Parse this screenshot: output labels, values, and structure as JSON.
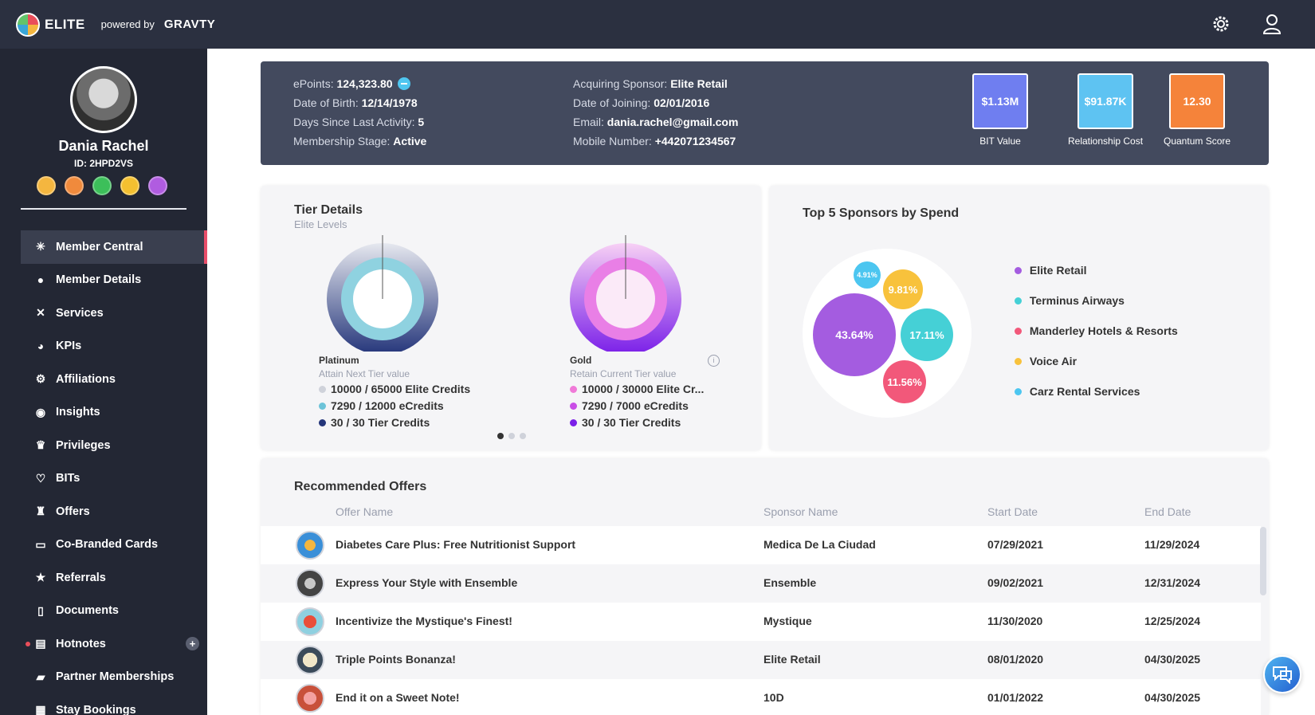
{
  "header": {
    "brand": "ELITE",
    "powered_by": "powered by",
    "platform": "GRAVTY"
  },
  "profile": {
    "name": "Dania Rachel",
    "id_label": "ID: 2HPD2VS",
    "badge_colors": [
      "#f4b63f",
      "#f08a3c",
      "#3cbf5a",
      "#f4c030",
      "#b05ce0"
    ]
  },
  "nav": [
    {
      "label": "Member Central",
      "icon": "asterisk-icon"
    },
    {
      "label": "Member Details",
      "icon": "person-icon"
    },
    {
      "label": "Services",
      "icon": "tools-icon"
    },
    {
      "label": "KPIs",
      "icon": "pie-icon"
    },
    {
      "label": "Affiliations",
      "icon": "gear-icon"
    },
    {
      "label": "Insights",
      "icon": "bulb-icon"
    },
    {
      "label": "Privileges",
      "icon": "crown-icon"
    },
    {
      "label": "BITs",
      "icon": "heart-pulse-icon"
    },
    {
      "label": "Offers",
      "icon": "trophy-icon"
    },
    {
      "label": "Co-Branded Cards",
      "icon": "card-icon"
    },
    {
      "label": "Referrals",
      "icon": "star-icon"
    },
    {
      "label": "Documents",
      "icon": "document-icon"
    },
    {
      "label": "Hotnotes",
      "icon": "notepad-icon"
    },
    {
      "label": "Partner Memberships",
      "icon": "partner-icon"
    },
    {
      "label": "Stay Bookings",
      "icon": "building-icon"
    }
  ],
  "summary": {
    "epoints_label": "ePoints:",
    "epoints": "124,323.80",
    "dob_label": "Date of Birth:",
    "dob": "12/14/1978",
    "days_label": "Days Since Last Activity:",
    "days": "5",
    "stage_label": "Membership Stage:",
    "stage": "Active",
    "sponsor_label": "Acquiring Sponsor:",
    "sponsor": "Elite Retail",
    "joining_label": "Date of Joining:",
    "joining": "02/01/2016",
    "email_label": "Email:",
    "email": "dania.rachel@gmail.com",
    "mobile_label": "Mobile Number:",
    "mobile": "+442071234567"
  },
  "kpis": [
    {
      "value": "$1.13M",
      "label": "BIT Value",
      "color": "#6f7ef0"
    },
    {
      "value": "$91.87K",
      "label": "Relationship Cost",
      "color": "#5ec3f2"
    },
    {
      "value": "12.30",
      "label": "Quantum Score",
      "color": "#f5833a"
    }
  ],
  "tier": {
    "title": "Tier Details",
    "subtitle": "Elite Levels",
    "left": {
      "name": "Platinum",
      "hint": "Attain Next Tier value",
      "stats": [
        {
          "text": "10000 / 65000 Elite Credits",
          "color": "#cfd2da"
        },
        {
          "text": "7290 / 12000 eCredits",
          "color": "#6cc3d8"
        },
        {
          "text": "30 / 30 Tier Credits",
          "color": "#24357a"
        }
      ]
    },
    "right": {
      "name": "Gold",
      "hint": "Retain Current Tier value",
      "stats": [
        {
          "text": "10000 / 30000 Elite Cr...",
          "color": "#f07ad8"
        },
        {
          "text": "7290 / 7000 eCredits",
          "color": "#c94ee6"
        },
        {
          "text": "30 / 30 Tier Credits",
          "color": "#7a1fe8"
        }
      ]
    }
  },
  "sponsors": {
    "title": "Top 5 Sponsors by Spend",
    "bubbles": [
      "43.64%",
      "17.11%",
      "11.56%",
      "9.81%",
      "4.91%"
    ],
    "legend": [
      {
        "name": "Elite Retail",
        "color": "#a45ce0"
      },
      {
        "name": "Terminus Airways",
        "color": "#45d0d6"
      },
      {
        "name": "Manderley Hotels & Resorts",
        "color": "#f2587a"
      },
      {
        "name": "Voice Air",
        "color": "#f8c23c"
      },
      {
        "name": "Carz Rental Services",
        "color": "#4cc6f0"
      }
    ]
  },
  "offers": {
    "title": "Recommended Offers",
    "columns": [
      "Offer Name",
      "Sponsor Name",
      "Start Date",
      "End Date"
    ],
    "rows": [
      {
        "name": "Diabetes Care Plus: Free Nutritionist Support",
        "sponsor": "Medica De La Ciudad",
        "start": "07/29/2021",
        "end": "11/29/2024"
      },
      {
        "name": "Express Your Style with Ensemble",
        "sponsor": "Ensemble",
        "start": "09/02/2021",
        "end": "12/31/2024"
      },
      {
        "name": "Incentivize the Mystique's Finest!",
        "sponsor": "Mystique",
        "start": "11/30/2020",
        "end": "12/25/2024"
      },
      {
        "name": "Triple Points Bonanza!",
        "sponsor": "Elite Retail",
        "start": "08/01/2020",
        "end": "04/30/2025"
      },
      {
        "name": "End it on a Sweet Note!",
        "sponsor": "10D",
        "start": "01/01/2022",
        "end": "04/30/2025"
      }
    ]
  }
}
